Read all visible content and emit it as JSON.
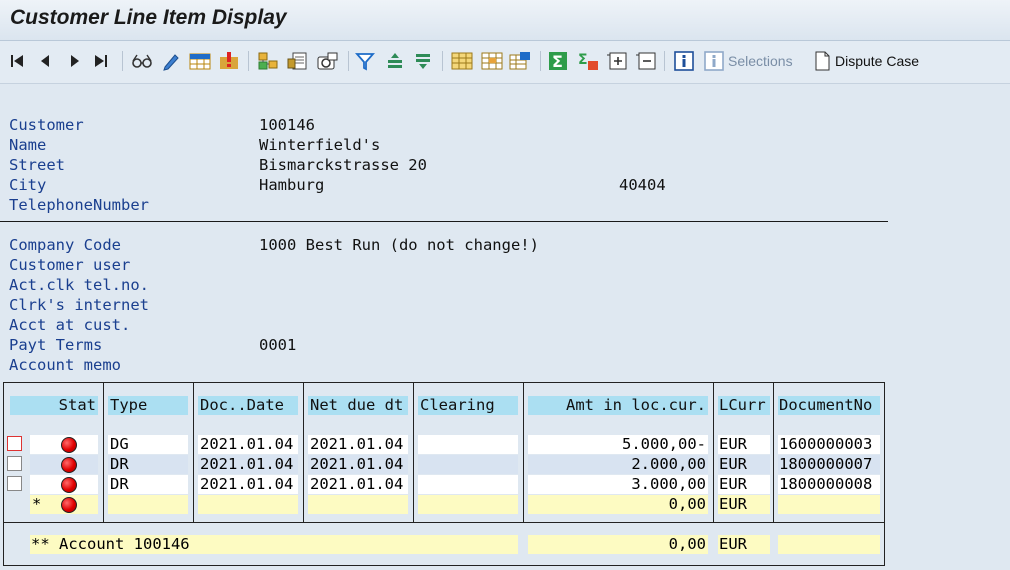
{
  "window": {
    "title": "Customer Line Item Display"
  },
  "toolbar": {
    "selections_label": "Selections",
    "dispute_label": "Dispute Case",
    "icons": [
      "first-page",
      "previous-page",
      "next-page",
      "last-page",
      "glasses",
      "pencil",
      "grid-edit",
      "warning",
      "tree",
      "document",
      "camera",
      "filter",
      "sort-asc",
      "sort-desc",
      "table",
      "layout",
      "change-layout",
      "sum",
      "subtotal",
      "expand",
      "collapse",
      "info",
      "selections-info",
      "dispute-document"
    ]
  },
  "header": {
    "customer_label": "Customer",
    "customer_value": "100146",
    "name_label": "Name",
    "name_value": "Winterfield's",
    "street_label": "Street",
    "street_value": "Bismarckstrasse 20",
    "city_label": "City",
    "city_value": "Hamburg",
    "postal_code": "40404",
    "telephone_label": "TelephoneNumber",
    "company_code_label": "Company Code",
    "company_code_value": "1000 Best Run (do not change!)",
    "customer_user_label": "Customer user",
    "act_clk_label": "Act.clk tel.no.",
    "clrk_internet_label": "Clrk's internet",
    "acct_at_cust_label": "Acct at cust.",
    "payt_terms_label": "Payt Terms",
    "payt_terms_value": "0001",
    "account_memo_label": "Account memo"
  },
  "table": {
    "columns": [
      "Stat",
      "Type",
      "Doc..Date",
      "Net due dt",
      "Clearing",
      "Amt in loc.cur.",
      "LCurr",
      "DocumentNo"
    ],
    "rows": [
      {
        "type": "DG",
        "doc_date": "2021.01.04",
        "net_due": "2021.01.04",
        "clearing": "",
        "amount": "5.000,00-",
        "curr": "EUR",
        "doc_no": "1600000003"
      },
      {
        "type": "DR",
        "doc_date": "2021.01.04",
        "net_due": "2021.01.04",
        "clearing": "",
        "amount": "2.000,00",
        "curr": "EUR",
        "doc_no": "1800000007"
      },
      {
        "type": "DR",
        "doc_date": "2021.01.04",
        "net_due": "2021.01.04",
        "clearing": "",
        "amount": "3.000,00",
        "curr": "EUR",
        "doc_no": "1800000008"
      }
    ],
    "total_marker": "*",
    "total_amount": "0,00",
    "total_curr": "EUR",
    "account_total_label": "** Account 100146",
    "account_total_amount": "0,00",
    "account_total_curr": "EUR"
  },
  "colors": {
    "status_red": "#e00000",
    "header_cell": "#abdff2",
    "total_row": "#fdfbc2",
    "label_blue": "#1a3f8f"
  }
}
